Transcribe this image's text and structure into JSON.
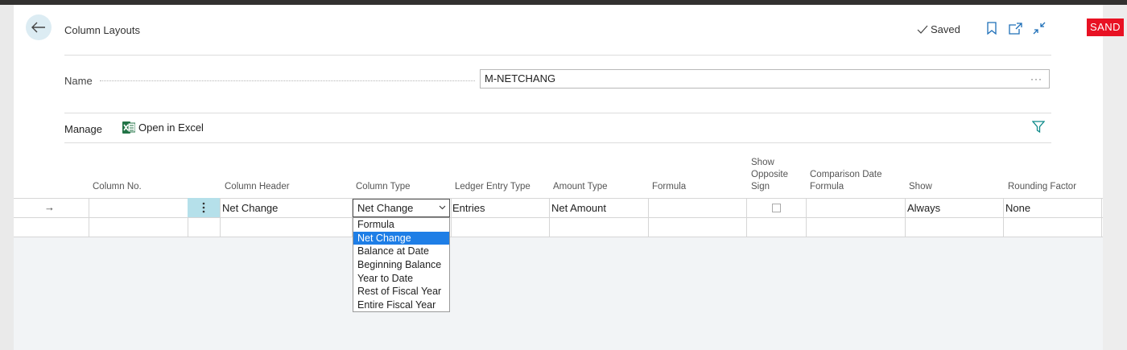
{
  "badge": {
    "environment": "SAND"
  },
  "header": {
    "title": "Column Layouts",
    "saved_label": "Saved",
    "icons": [
      "back-arrow-icon",
      "bookmark-icon",
      "open-new-window-icon",
      "collapse-icon"
    ]
  },
  "name_field": {
    "label": "Name",
    "value": "M-NETCHANG",
    "more_label": "···"
  },
  "actions": {
    "manage_label": "Manage",
    "open_in_excel_label": "Open in Excel"
  },
  "columns": {
    "column_no": "Column No.",
    "column_header": "Column Header",
    "column_type": "Column Type",
    "ledger_entry_type": "Ledger Entry Type",
    "amount_type": "Amount Type",
    "formula": "Formula",
    "show_opposite_sign": "Show Opposite Sign",
    "comparison_date_formula": "Comparison Date Formula",
    "show": "Show",
    "rounding_factor": "Rounding Factor"
  },
  "row": {
    "indicator": "→",
    "column_no": "",
    "column_header": "Net Change",
    "column_type": "Net Change",
    "ledger_entry_type": "Entries",
    "amount_type": "Net Amount",
    "formula": "",
    "show_opposite_sign": false,
    "comparison_date_formula": "",
    "show": "Always",
    "rounding_factor": "None"
  },
  "dropdown": {
    "options": [
      "Formula",
      "Net Change",
      "Balance at Date",
      "Beginning Balance",
      "Year to Date",
      "Rest of Fiscal Year",
      "Entire Fiscal Year"
    ],
    "selected": "Net Change"
  },
  "colors": {
    "accent": "#1e7ee6",
    "badge": "#e81123",
    "selected_row_menu": "#b5e0ea",
    "excel_green": "#217346",
    "filter": "#0f8a8a"
  }
}
